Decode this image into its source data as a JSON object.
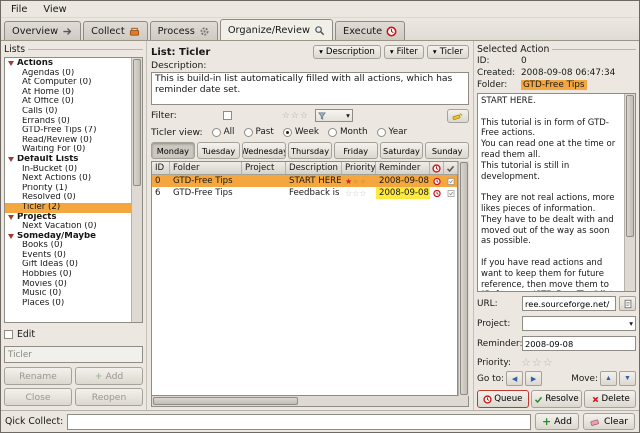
{
  "menu": {
    "file": "File",
    "view": "View"
  },
  "tabs": {
    "overview": "Overview",
    "collect": "Collect",
    "process": "Process",
    "organize": "Organize/Review",
    "execute": "Execute"
  },
  "lists": {
    "title": "Lists",
    "items": [
      {
        "label": "Actions",
        "type": "group"
      },
      {
        "label": "Agendas (0)"
      },
      {
        "label": "At Computer (0)"
      },
      {
        "label": "At Home (0)"
      },
      {
        "label": "At Office (0)"
      },
      {
        "label": "Calls (0)"
      },
      {
        "label": "Errands (0)"
      },
      {
        "label": "GTD-Free Tips (7)"
      },
      {
        "label": "Read/Review (0)"
      },
      {
        "label": "Waiting For (0)"
      },
      {
        "label": "Default Lists",
        "type": "group"
      },
      {
        "label": "In-Bucket (0)"
      },
      {
        "label": "Next Actions (0)"
      },
      {
        "label": "Priority (1)"
      },
      {
        "label": "Resolved (0)"
      },
      {
        "label": "Ticler (2)",
        "selected": true
      },
      {
        "label": "Projects",
        "type": "group"
      },
      {
        "label": "Next Vacation (0)"
      },
      {
        "label": "Someday/Maybe",
        "type": "group"
      },
      {
        "label": "Books (0)"
      },
      {
        "label": "Events (0)"
      },
      {
        "label": "Gift Ideas (0)"
      },
      {
        "label": "Hobbies (0)"
      },
      {
        "label": "Movies (0)"
      },
      {
        "label": "Music (0)"
      },
      {
        "label": "Places (0)"
      }
    ],
    "edit_label": "Edit",
    "name_value": "Ticler",
    "rename_label": "Rename",
    "add_label": "Add",
    "close_label": "Close",
    "reopen_label": "Reopen"
  },
  "list_view": {
    "title": "List: Ticler",
    "toggles": {
      "description": "Description",
      "filter": "Filter",
      "ticler": "Ticler"
    },
    "description_label": "Description:",
    "description_text": "This is build-in list automatically filled with all actions, which has reminder date set.",
    "filter_label": "Filter:",
    "view_label": "Ticler view:",
    "periods": [
      "All",
      "Past",
      "Week",
      "Month",
      "Year"
    ],
    "selected_period": "Week",
    "days": [
      "Monday",
      "Tuesday",
      "Wednesday",
      "Thursday",
      "Friday",
      "Saturday",
      "Sunday"
    ],
    "selected_day": "Monday",
    "table": {
      "columns": [
        "ID",
        "Folder",
        "Project",
        "Description",
        "Priority",
        "Reminder"
      ],
      "rows": [
        {
          "id": "0",
          "folder": "GTD-Free Tips",
          "project": "",
          "description": "START HERE ...",
          "reminder": "2008-09-08"
        },
        {
          "id": "6",
          "folder": "GTD-Free Tips",
          "project": "",
          "description": "Feedback is ...",
          "reminder": "2008-09-08"
        }
      ]
    }
  },
  "selected_action": {
    "title": "Selected Action",
    "id_label": "ID:",
    "id_value": "0",
    "created_label": "Created:",
    "created_value": "2008-09-08 06:47:34",
    "folder_label": "Folder:",
    "folder_value": "GTD-Free Tips",
    "description": "START HERE.\n\nThis tutorial is in form of GTD-Free actions.\nYou can read one at the time or read them all.\nThis tutorial is still in development.\n\nThey are not real actions, more likes pieces of information.\nThey have to be dealt with and moved out of the way as soon as possible.\n\nIf you have read actions and want to keep them for future reference, then move them to \"References/GTD-Free Tips\" list",
    "url_label": "URL:",
    "url_value": "ree.sourceforge.net/",
    "project_label": "Project:",
    "reminder_label": "Reminder:",
    "reminder_value": "2008-09-08",
    "priority_label": "Priority:",
    "goto_label": "Go to:",
    "move_label": "Move:",
    "queue_label": "Queue",
    "resolve_label": "Resolve",
    "delete_label": "Delete"
  },
  "quick_collect": {
    "label": "Qick Collect:",
    "value": "",
    "add_label": "Add",
    "clear_label": "Clear"
  },
  "icons": {
    "dropdown": "▾",
    "star_filled": "★",
    "star_empty": "☆",
    "plus": "+",
    "arrow_left": "◀",
    "arrow_right": "▶",
    "arrow_up": "▲",
    "arrow_down": "▼"
  },
  "colors": {
    "selection_orange": "#f5a73f",
    "highlight_yellow": "#ffe93d",
    "queue_red": "#cc1111",
    "resolve_green": "#2c8a2c"
  }
}
